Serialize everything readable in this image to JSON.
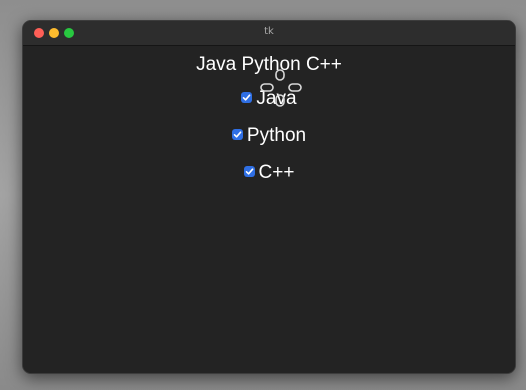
{
  "window": {
    "title": "tk"
  },
  "main_label": "Java Python C++",
  "checkboxes": [
    {
      "label": "Java",
      "checked": true
    },
    {
      "label": "Python",
      "checked": true
    },
    {
      "label": "C++",
      "checked": true
    }
  ],
  "colors": {
    "window_bg": "#232323",
    "checkbox_accent": "#2f6fe4",
    "text": "#ffffff"
  }
}
